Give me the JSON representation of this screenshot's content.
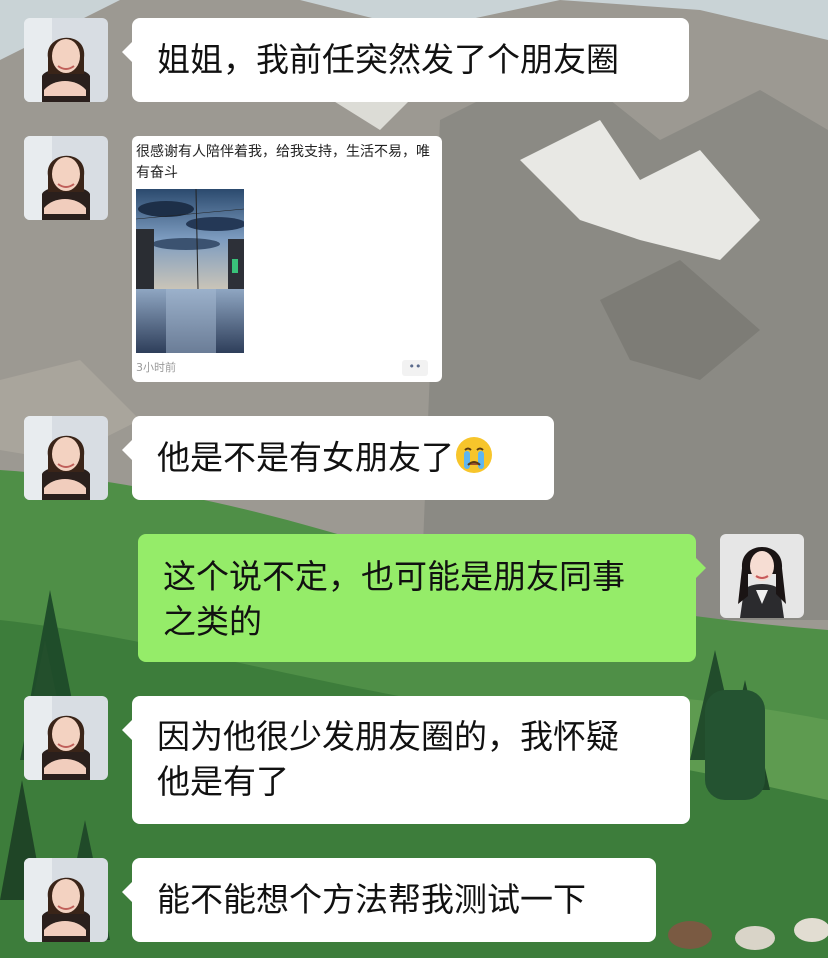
{
  "chat": {
    "messages": [
      {
        "side": "left",
        "lines": [
          "姐姐，我前任突然发了个朋友圈"
        ]
      },
      {
        "side": "left",
        "moment": {
          "text": "很感谢有人陪伴着我，给我支持，生活不易，唯有奋斗",
          "time": "3小时前",
          "more": "••"
        }
      },
      {
        "side": "left",
        "lines": [
          "他是不是有女朋友了"
        ],
        "emoji": "crying-face"
      },
      {
        "side": "right",
        "lines": [
          "这个说不定，也可能是朋友同事",
          "之类的"
        ]
      },
      {
        "side": "left",
        "lines": [
          "因为他很少发朋友圈的，我怀疑",
          "他是有了"
        ]
      },
      {
        "side": "left",
        "lines": [
          "能不能想个方法帮我测试一下"
        ]
      }
    ]
  },
  "colors": {
    "incoming_bubble": "#ffffff",
    "outgoing_bubble": "#95ec69"
  }
}
